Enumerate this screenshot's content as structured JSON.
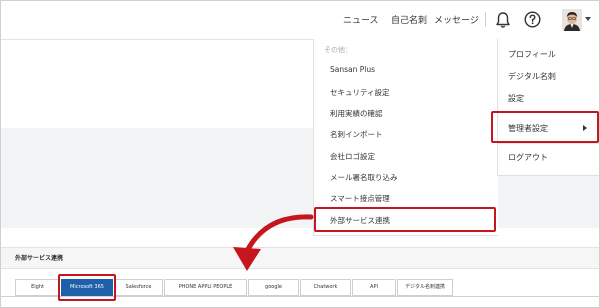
{
  "header": {
    "nav": [
      "ニュース",
      "自己名刺",
      "メッセージ"
    ],
    "icons": [
      "bell-icon",
      "help-icon",
      "avatar",
      "chevron-down-icon"
    ]
  },
  "user_menu": {
    "items": [
      "プロフィール",
      "デジタル名刺",
      "設定"
    ],
    "admin": "管理者設定",
    "logout": "ログアウト"
  },
  "admin_submenu": {
    "heading": "その他：",
    "items": [
      "Sansan Plus",
      "セキュリティ設定",
      "利用実績の確認",
      "名刺インポート",
      "会社ロゴ設定",
      "メール署名取り込み",
      "スマート接点管理",
      "外部サービス連携"
    ]
  },
  "page": {
    "section_title": "外部サービス連携",
    "tabs": [
      "Eight",
      "Microsoft 365",
      "Salesforce",
      "PHONE APPLI PEOPLE",
      "google",
      "Chatwork",
      "API",
      "デジタル名刺連携"
    ],
    "active_tab": "Microsoft 365"
  },
  "colors": {
    "highlight": "#c4161c",
    "active_tab": "#1d5fa8"
  }
}
